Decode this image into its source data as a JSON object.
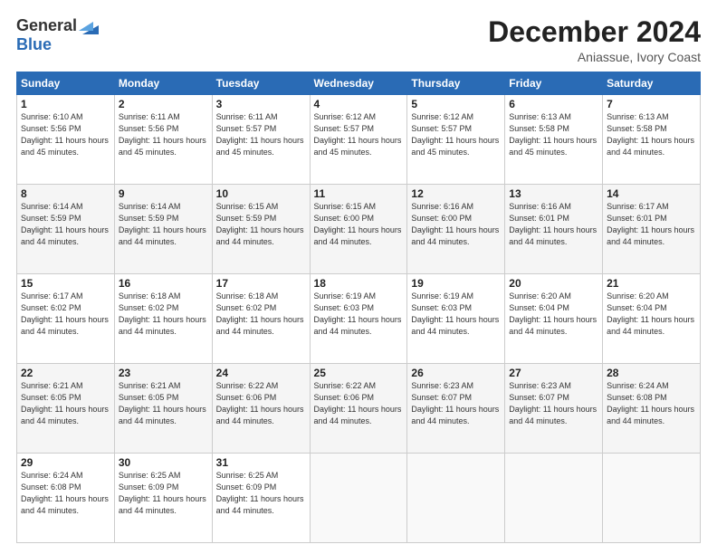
{
  "header": {
    "logo_general": "General",
    "logo_blue": "Blue",
    "month_title": "December 2024",
    "location": "Aniassue, Ivory Coast"
  },
  "weekdays": [
    "Sunday",
    "Monday",
    "Tuesday",
    "Wednesday",
    "Thursday",
    "Friday",
    "Saturday"
  ],
  "weeks": [
    [
      {
        "day": "1",
        "sunrise": "6:10 AM",
        "sunset": "5:56 PM",
        "daylight": "11 hours and 45 minutes."
      },
      {
        "day": "2",
        "sunrise": "6:11 AM",
        "sunset": "5:56 PM",
        "daylight": "11 hours and 45 minutes."
      },
      {
        "day": "3",
        "sunrise": "6:11 AM",
        "sunset": "5:57 PM",
        "daylight": "11 hours and 45 minutes."
      },
      {
        "day": "4",
        "sunrise": "6:12 AM",
        "sunset": "5:57 PM",
        "daylight": "11 hours and 45 minutes."
      },
      {
        "day": "5",
        "sunrise": "6:12 AM",
        "sunset": "5:57 PM",
        "daylight": "11 hours and 45 minutes."
      },
      {
        "day": "6",
        "sunrise": "6:13 AM",
        "sunset": "5:58 PM",
        "daylight": "11 hours and 45 minutes."
      },
      {
        "day": "7",
        "sunrise": "6:13 AM",
        "sunset": "5:58 PM",
        "daylight": "11 hours and 44 minutes."
      }
    ],
    [
      {
        "day": "8",
        "sunrise": "6:14 AM",
        "sunset": "5:59 PM",
        "daylight": "11 hours and 44 minutes."
      },
      {
        "day": "9",
        "sunrise": "6:14 AM",
        "sunset": "5:59 PM",
        "daylight": "11 hours and 44 minutes."
      },
      {
        "day": "10",
        "sunrise": "6:15 AM",
        "sunset": "5:59 PM",
        "daylight": "11 hours and 44 minutes."
      },
      {
        "day": "11",
        "sunrise": "6:15 AM",
        "sunset": "6:00 PM",
        "daylight": "11 hours and 44 minutes."
      },
      {
        "day": "12",
        "sunrise": "6:16 AM",
        "sunset": "6:00 PM",
        "daylight": "11 hours and 44 minutes."
      },
      {
        "day": "13",
        "sunrise": "6:16 AM",
        "sunset": "6:01 PM",
        "daylight": "11 hours and 44 minutes."
      },
      {
        "day": "14",
        "sunrise": "6:17 AM",
        "sunset": "6:01 PM",
        "daylight": "11 hours and 44 minutes."
      }
    ],
    [
      {
        "day": "15",
        "sunrise": "6:17 AM",
        "sunset": "6:02 PM",
        "daylight": "11 hours and 44 minutes."
      },
      {
        "day": "16",
        "sunrise": "6:18 AM",
        "sunset": "6:02 PM",
        "daylight": "11 hours and 44 minutes."
      },
      {
        "day": "17",
        "sunrise": "6:18 AM",
        "sunset": "6:02 PM",
        "daylight": "11 hours and 44 minutes."
      },
      {
        "day": "18",
        "sunrise": "6:19 AM",
        "sunset": "6:03 PM",
        "daylight": "11 hours and 44 minutes."
      },
      {
        "day": "19",
        "sunrise": "6:19 AM",
        "sunset": "6:03 PM",
        "daylight": "11 hours and 44 minutes."
      },
      {
        "day": "20",
        "sunrise": "6:20 AM",
        "sunset": "6:04 PM",
        "daylight": "11 hours and 44 minutes."
      },
      {
        "day": "21",
        "sunrise": "6:20 AM",
        "sunset": "6:04 PM",
        "daylight": "11 hours and 44 minutes."
      }
    ],
    [
      {
        "day": "22",
        "sunrise": "6:21 AM",
        "sunset": "6:05 PM",
        "daylight": "11 hours and 44 minutes."
      },
      {
        "day": "23",
        "sunrise": "6:21 AM",
        "sunset": "6:05 PM",
        "daylight": "11 hours and 44 minutes."
      },
      {
        "day": "24",
        "sunrise": "6:22 AM",
        "sunset": "6:06 PM",
        "daylight": "11 hours and 44 minutes."
      },
      {
        "day": "25",
        "sunrise": "6:22 AM",
        "sunset": "6:06 PM",
        "daylight": "11 hours and 44 minutes."
      },
      {
        "day": "26",
        "sunrise": "6:23 AM",
        "sunset": "6:07 PM",
        "daylight": "11 hours and 44 minutes."
      },
      {
        "day": "27",
        "sunrise": "6:23 AM",
        "sunset": "6:07 PM",
        "daylight": "11 hours and 44 minutes."
      },
      {
        "day": "28",
        "sunrise": "6:24 AM",
        "sunset": "6:08 PM",
        "daylight": "11 hours and 44 minutes."
      }
    ],
    [
      {
        "day": "29",
        "sunrise": "6:24 AM",
        "sunset": "6:08 PM",
        "daylight": "11 hours and 44 minutes."
      },
      {
        "day": "30",
        "sunrise": "6:25 AM",
        "sunset": "6:09 PM",
        "daylight": "11 hours and 44 minutes."
      },
      {
        "day": "31",
        "sunrise": "6:25 AM",
        "sunset": "6:09 PM",
        "daylight": "11 hours and 44 minutes."
      },
      null,
      null,
      null,
      null
    ]
  ]
}
